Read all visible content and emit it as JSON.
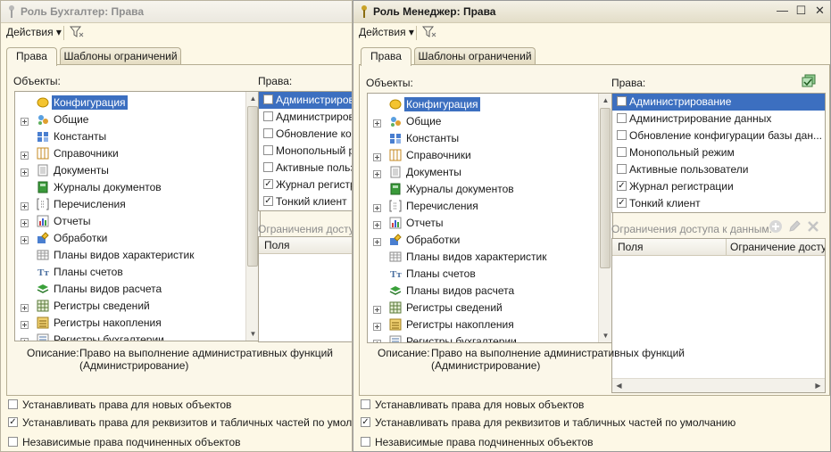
{
  "windows": [
    {
      "title": "Роль Бухгалтер: Права",
      "actions_label": "Действия",
      "tabs": [
        "Права",
        "Шаблоны ограничений"
      ],
      "objects_label": "Объекты:",
      "rights_label": "Права:",
      "restrictions_label": "Ограничения доступа",
      "grid_columns": [
        "Поля"
      ],
      "tree": [
        "Конфигурация",
        "Общие",
        "Константы",
        "Справочники",
        "Документы",
        "Журналы документов",
        "Перечисления",
        "Отчеты",
        "Обработки",
        "Планы видов характеристик",
        "Планы счетов",
        "Планы видов расчета",
        "Регистры сведений",
        "Регистры накопления",
        "Регистры бухгалтерии"
      ],
      "rights": [
        {
          "label": "Администрирова",
          "checked": false
        },
        {
          "label": "Администрирова",
          "checked": false
        },
        {
          "label": "Обновление конф",
          "checked": false
        },
        {
          "label": "Монопольный реж",
          "checked": false
        },
        {
          "label": "Активные пользо",
          "checked": false
        },
        {
          "label": "Журнал регистра",
          "checked": true
        },
        {
          "label": "Тонкий клиент",
          "checked": true
        }
      ],
      "description_label": "Описание:",
      "description_line1": "Право на выполнение административных функций",
      "description_line2": "(Администрирование)",
      "options": [
        {
          "label": "Устанавливать права для новых объектов",
          "checked": false
        },
        {
          "label": "Устанавливать права для реквизитов и табличных частей по умолчанию",
          "checked": true
        },
        {
          "label": "Независимые права подчиненных объектов",
          "checked": false
        }
      ]
    },
    {
      "title": "Роль Менеджер: Права",
      "actions_label": "Действия",
      "tabs": [
        "Права",
        "Шаблоны ограничений"
      ],
      "objects_label": "Объекты:",
      "rights_label": "Права:",
      "restrictions_label": "Ограничения доступа к данным:",
      "grid_columns": [
        "Поля",
        "Ограничение доступа"
      ],
      "tree": [
        "Конфигурация",
        "Общие",
        "Константы",
        "Справочники",
        "Документы",
        "Журналы документов",
        "Перечисления",
        "Отчеты",
        "Обработки",
        "Планы видов характеристик",
        "Планы счетов",
        "Планы видов расчета",
        "Регистры сведений",
        "Регистры накопления",
        "Регистры бухгалтерии"
      ],
      "rights": [
        {
          "label": "Администрирование",
          "checked": false
        },
        {
          "label": "Администрирование данных",
          "checked": false
        },
        {
          "label": "Обновление конфигурации базы дан...",
          "checked": false
        },
        {
          "label": "Монопольный режим",
          "checked": false
        },
        {
          "label": "Активные пользователи",
          "checked": false
        },
        {
          "label": "Журнал регистрации",
          "checked": true
        },
        {
          "label": "Тонкий клиент",
          "checked": true
        }
      ],
      "description_label": "Описание:",
      "description_line1": "Право на выполнение административных функций",
      "description_line2": "(Администрирование)",
      "options": [
        {
          "label": "Устанавливать права для новых объектов",
          "checked": false
        },
        {
          "label": "Устанавливать права для реквизитов и табличных частей по умолчанию",
          "checked": true
        },
        {
          "label": "Независимые права подчиненных объектов",
          "checked": false
        }
      ]
    }
  ],
  "colors": {
    "selection": "#3c6fc0",
    "window_bg": "#fdf8e6"
  },
  "icons": {
    "tree": [
      "configuration-icon",
      "common-icon",
      "constants-icon",
      "catalogs-icon",
      "documents-icon",
      "document-journals-icon",
      "enums-icon",
      "reports-icon",
      "data-processors-icon",
      "chart-of-characteristic-types-icon",
      "chart-of-accounts-icon",
      "chart-of-calculation-types-icon",
      "information-registers-icon",
      "accumulation-registers-icon",
      "accounting-registers-icon"
    ]
  }
}
